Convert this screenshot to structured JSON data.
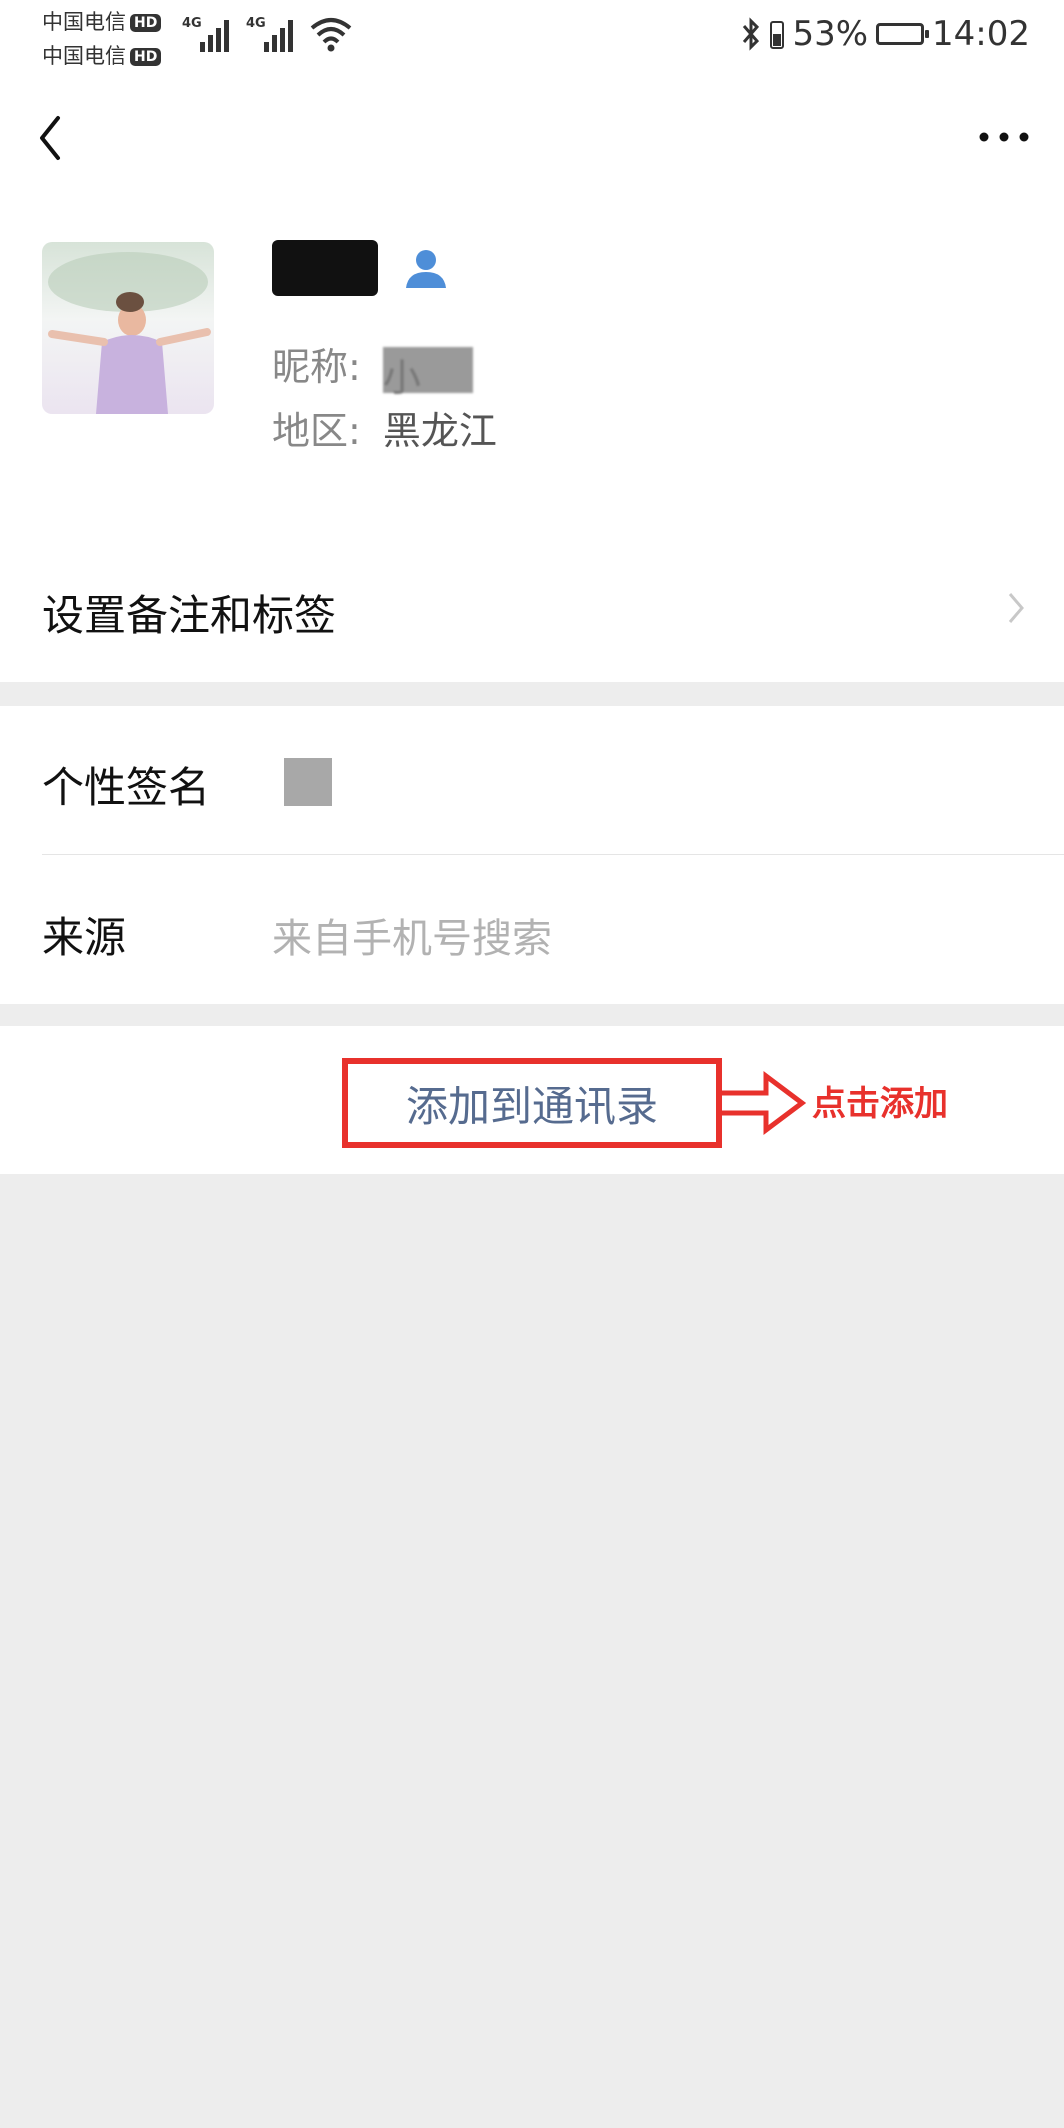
{
  "status_bar": {
    "carrier1": "中国电信",
    "carrier2": "中国电信",
    "hd": "HD",
    "network": "4G",
    "battery": "53%",
    "time": "14:02"
  },
  "profile": {
    "name": "",
    "nickname_label": "昵称:",
    "nickname_value": "小",
    "region_label": "地区:",
    "region_value": "黑龙江"
  },
  "rows": {
    "remark_label": "设置备注和标签",
    "signature_label": "个性签名",
    "source_label": "来源",
    "source_value": "来自手机号搜索"
  },
  "action": {
    "add_label": "添加到通讯录",
    "hint": "点击添加",
    "accent_color": "#e8312c",
    "link_color": "#566b8f"
  }
}
